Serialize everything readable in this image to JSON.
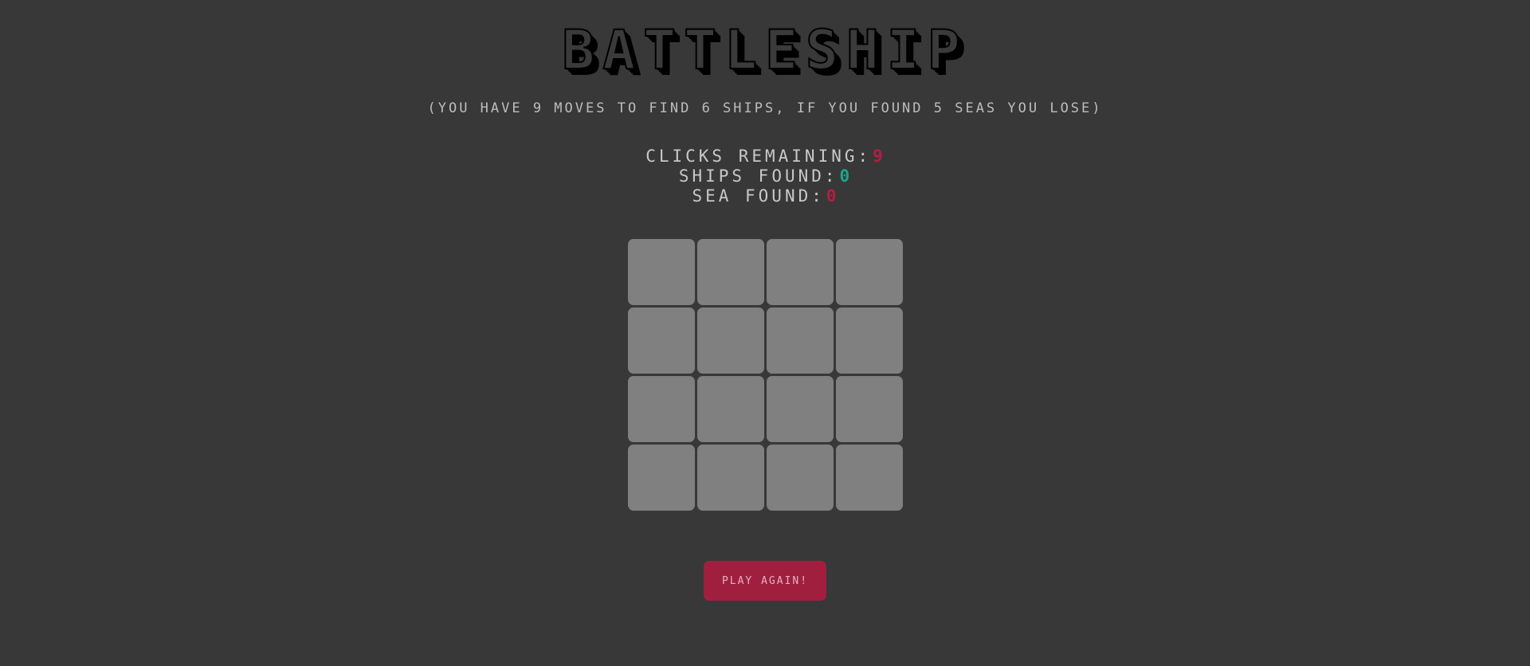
{
  "header": {
    "title": "BATTLESHIP",
    "subtitle": "(YOU HAVE 9 MOVES TO FIND 6 SHIPS, IF YOU FOUND 5 SEAS YOU LOSE)"
  },
  "stats": {
    "clicks_label": "CLICKS REMAINING:",
    "clicks_value": "9",
    "ships_label": "SHIPS FOUND:",
    "ships_value": "0",
    "sea_label": "SEA FOUND:",
    "sea_value": "0"
  },
  "board": {
    "rows": 4,
    "cols": 4,
    "cell_state": "hidden"
  },
  "actions": {
    "play_again_label": "PLAY AGAIN!"
  },
  "colors": {
    "background": "#383838",
    "cell": "#808080",
    "accent_red": "#a01f3f",
    "accent_green": "#1aa58c"
  }
}
